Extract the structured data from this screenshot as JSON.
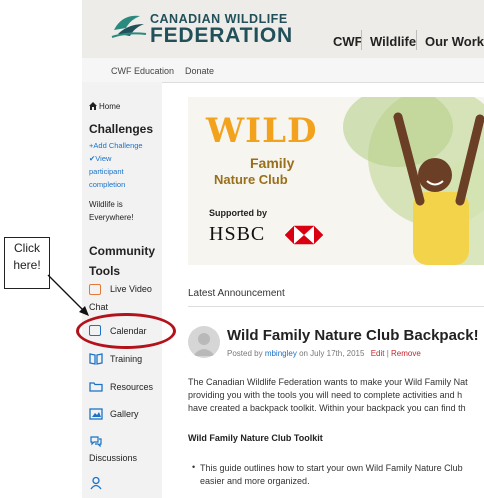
{
  "header": {
    "logo_top": "CANADIAN WILDLIFE",
    "logo_bottom": "FEDERATION",
    "nav": [
      "CWF",
      "Wildlife",
      "Our Work"
    ]
  },
  "subnav": [
    "CWF Education",
    "Donate"
  ],
  "sidebar": {
    "home": "Home",
    "challenges_heading": "Challenges",
    "add_challenge": "Add Challenge",
    "view_completion": [
      "View",
      "participant",
      "completion"
    ],
    "wildlife_text": [
      "Wildlife is",
      "Everywhere!"
    ],
    "community_heading": [
      "Community",
      "Tools"
    ],
    "tools": [
      "Live Video",
      "Calendar",
      "Training",
      "Resources",
      "Gallery",
      "Discussions"
    ],
    "chat_label": "Chat"
  },
  "callout": [
    "Click",
    "here!"
  ],
  "banner": {
    "wild": "WILD",
    "family": "Family",
    "nature_club": "Nature Club",
    "supported_by": "Supported by",
    "sponsor": "HSBC"
  },
  "main": {
    "section_title": "Latest Announcement",
    "post_title": "Wild Family Nature Club Backpack!",
    "posted_by": "Posted by",
    "author": "mbingley",
    "date": "on July 17th, 2015",
    "edit": "Edit",
    "separator": "|",
    "remove": "Remove",
    "body_lines": [
      "The Canadian Wildlife Federation wants to make your Wild Family Nat",
      "providing you with the tools you will need to complete activities and h",
      "have created a backpack toolkit. Within your backpack you can find th"
    ],
    "toolkit_heading": "Wild Family Nature Club Toolkit",
    "bullet_lines": [
      "This guide outlines how to start your own Wild Family Nature Club",
      "easier and more organized."
    ]
  },
  "colors": {
    "accent_blue": "#1a73c8",
    "brand_teal": "#22505a",
    "highlight_red": "#b3121b",
    "hsbc_red": "#db0011"
  }
}
